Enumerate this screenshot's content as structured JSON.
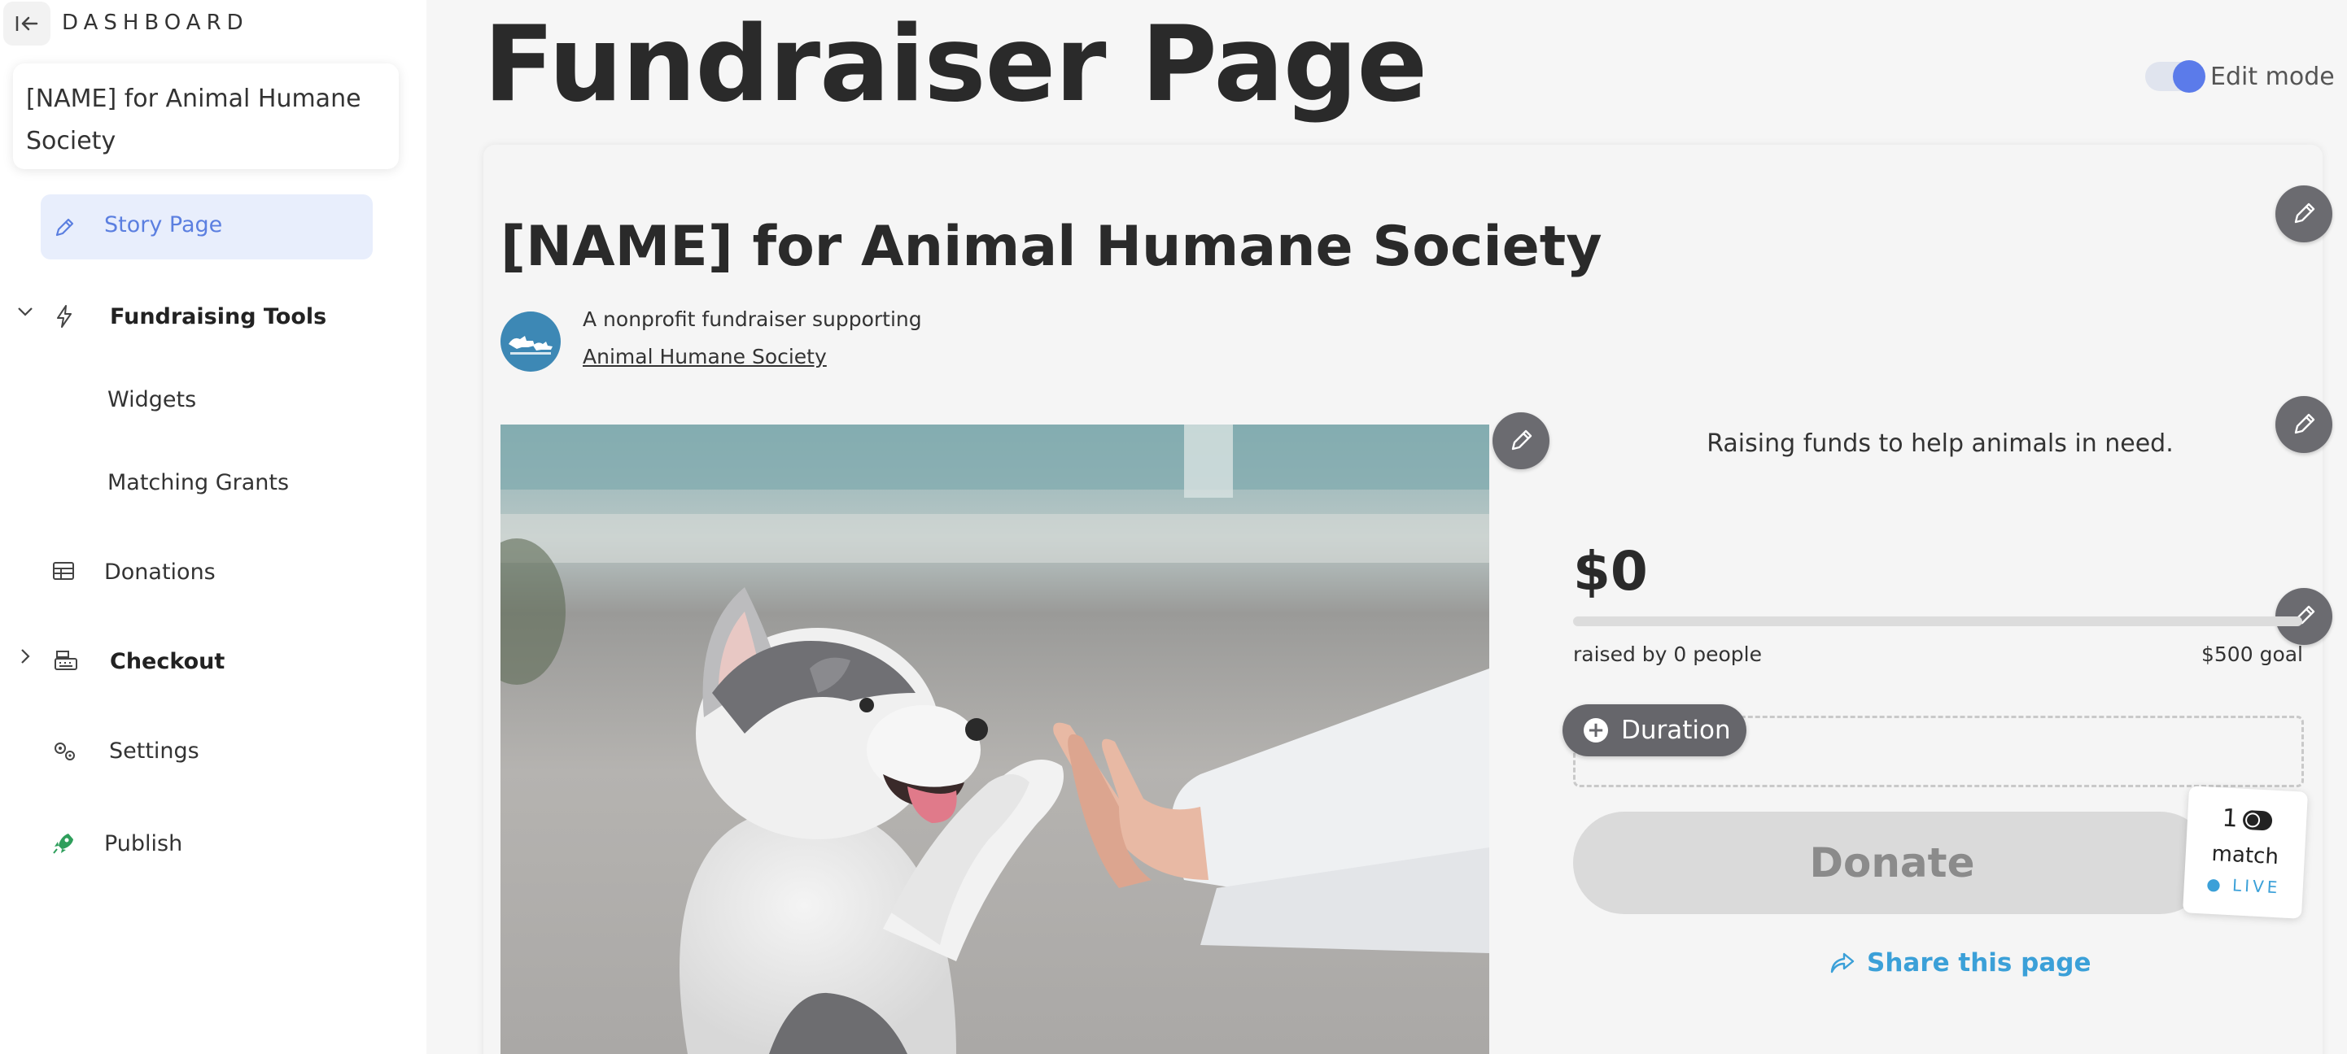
{
  "sidebar": {
    "brand": "DASHBOARD",
    "org_name": "[NAME] for Animal Humane Society",
    "items": [
      {
        "label": "Story Page",
        "icon": "pencil-icon",
        "active": true
      },
      {
        "label": "Fundraising Tools",
        "icon": "lightning-icon",
        "expanded": true
      },
      {
        "label": "Widgets"
      },
      {
        "label": "Matching Grants"
      },
      {
        "label": "Donations",
        "icon": "table-icon"
      },
      {
        "label": "Checkout",
        "icon": "cash-register-icon",
        "expanded": false
      },
      {
        "label": "Settings",
        "icon": "gears-icon"
      },
      {
        "label": "Publish",
        "icon": "rocket-icon"
      }
    ]
  },
  "header": {
    "title": "Fundraiser Page",
    "edit_mode_label": "Edit mode",
    "edit_mode_on": true
  },
  "fundraiser": {
    "title": "[NAME] for Animal Humane Society",
    "subtitle": "A nonprofit fundraiser supporting",
    "org_link": "Animal Humane Society",
    "tagline": "Raising funds to help animals in need.",
    "amount": "$0",
    "progress_fraction": 0,
    "raised_by": "raised by 0 people",
    "goal": "$500 goal",
    "duration_label": "Duration",
    "donate_label": "Donate",
    "match_count": "1",
    "match_label": "match",
    "live_label": "LIVE",
    "share_label": "Share this page"
  },
  "colors": {
    "accent": "#5b7bea",
    "active_bg": "#e8eefc",
    "link": "#3ba0d8",
    "publish_green": "#2e9e5b"
  }
}
